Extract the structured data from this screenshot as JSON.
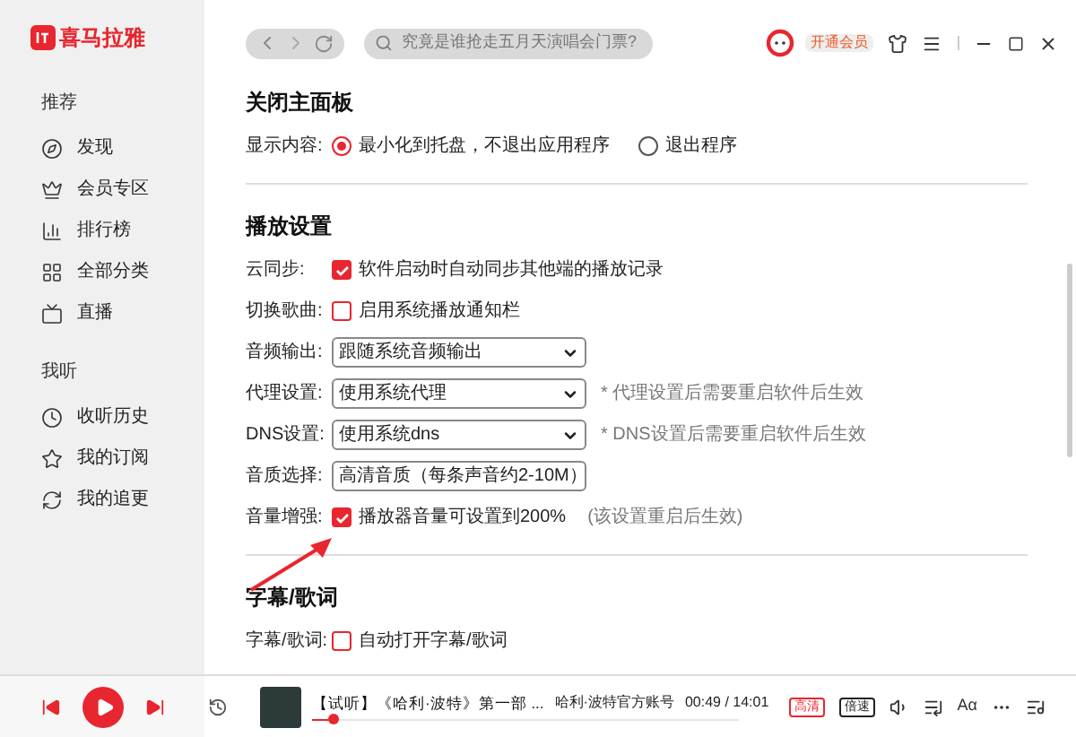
{
  "app": {
    "logo_text": "喜马拉雅"
  },
  "sidebar": {
    "groups": [
      {
        "title": "推荐",
        "items": [
          {
            "label": "发现"
          },
          {
            "label": "会员专区"
          },
          {
            "label": "排行榜"
          },
          {
            "label": "全部分类"
          },
          {
            "label": "直播"
          }
        ]
      },
      {
        "title": "我听",
        "items": [
          {
            "label": "收听历史"
          },
          {
            "label": "我的订阅"
          },
          {
            "label": "我的追更"
          }
        ]
      }
    ]
  },
  "header": {
    "search": {
      "placeholder": "究竟是谁抢走五月天演唱会门票?"
    },
    "vip_button": "开通会员"
  },
  "sections": [
    {
      "title": "关闭主面板",
      "rows": [
        {
          "kind": "radio",
          "label": "显示内容:",
          "options": [
            {
              "label": "最小化到托盘，不退出应用程序",
              "selected": true
            },
            {
              "label": "退出程序",
              "selected": false
            }
          ]
        }
      ]
    },
    {
      "title": "播放设置",
      "rows": [
        {
          "kind": "checkbox",
          "label": "云同步:",
          "text": "软件启动时自动同步其他端的播放记录",
          "checked": true
        },
        {
          "kind": "checkbox",
          "label": "切换歌曲:",
          "text": "启用系统播放通知栏",
          "checked": false
        },
        {
          "kind": "select",
          "label": "音频输出:",
          "value": "跟随系统音频输出"
        },
        {
          "kind": "select",
          "label": "代理设置:",
          "value": "使用系统代理",
          "note": "* 代理设置后需要重启软件后生效"
        },
        {
          "kind": "select",
          "label": "DNS设置:",
          "value": "使用系统dns",
          "note": "* DNS设置后需要重启软件后生效"
        },
        {
          "kind": "select",
          "label": "音质选择:",
          "value": "高清音质（每条声音约2-10M）"
        },
        {
          "kind": "checkbox",
          "label": "音量增强:",
          "text": "播放器音量可设置到200%",
          "checked": true,
          "note": "(该设置重启后生效)"
        }
      ]
    },
    {
      "title": "字幕/歌词",
      "rows": [
        {
          "kind": "checkbox",
          "label": "字幕/歌词:",
          "text": "自动打开字幕/歌词",
          "checked": false
        }
      ]
    }
  ],
  "player": {
    "title": "【试听】《哈利·波特》第一部 ...",
    "author": "哈利·波特官方账号",
    "time": "00:49 / 14:01",
    "level": 0.05,
    "quality_badge": "高清",
    "speed_badge": "倍速",
    "font_button": "Aα"
  }
}
